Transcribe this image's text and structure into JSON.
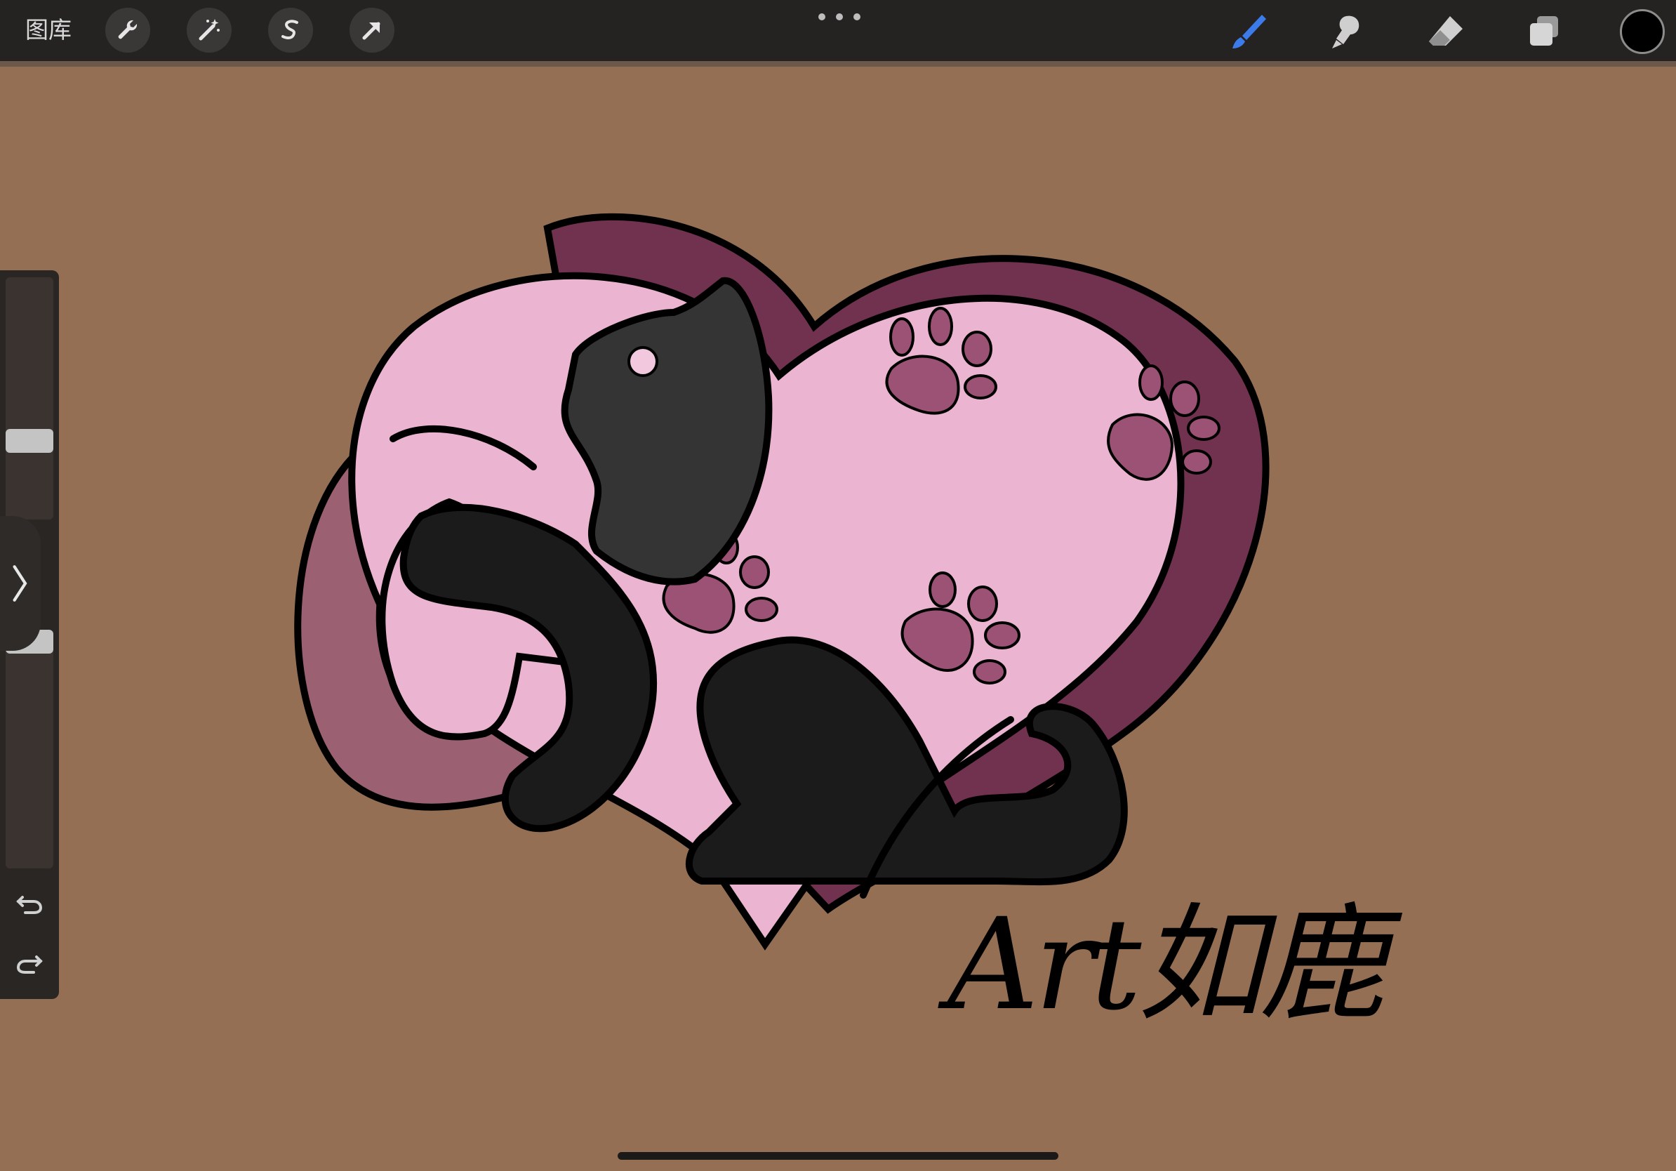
{
  "toolbar": {
    "gallery_label": "图库",
    "left_tools": [
      "wrench-icon",
      "magic-wand-icon",
      "selection-s-icon",
      "transform-arrow-icon"
    ],
    "right_tools": [
      "brush-icon",
      "smudge-icon",
      "eraser-icon",
      "layers-icon"
    ],
    "active_tool": "brush-icon",
    "active_tool_color": "#3b7bea",
    "current_color": "#000000"
  },
  "canvas": {
    "background_color": "#956f53",
    "signature_text": "Art如鹿"
  },
  "sidebar": {
    "brush_size_level": 0.69,
    "opacity_level": 0.0
  }
}
